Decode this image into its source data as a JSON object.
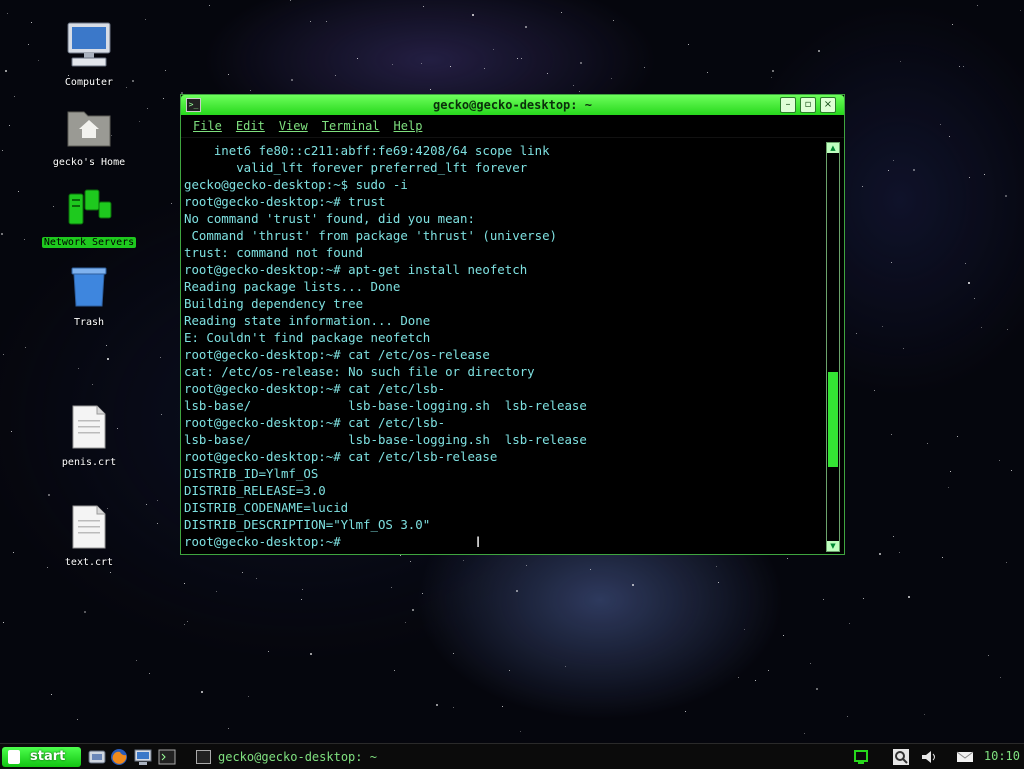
{
  "desktop": {
    "icons": [
      {
        "label": "Computer"
      },
      {
        "label": "gecko's Home"
      },
      {
        "label": "Network Servers"
      },
      {
        "label": "Trash"
      },
      {
        "label": "penis.crt"
      },
      {
        "label": "text.crt"
      }
    ]
  },
  "window": {
    "title": "gecko@gecko-desktop: ~",
    "menu": [
      "File",
      "Edit",
      "View",
      "Terminal",
      "Help"
    ],
    "lines": [
      "    inet6 fe80::c211:abff:fe69:4208/64 scope link",
      "       valid_lft forever preferred_lft forever",
      "gecko@gecko-desktop:~$ sudo -i",
      "root@gecko-desktop:~# trust",
      "No command 'trust' found, did you mean:",
      " Command 'thrust' from package 'thrust' (universe)",
      "trust: command not found",
      "root@gecko-desktop:~# apt-get install neofetch",
      "Reading package lists... Done",
      "Building dependency tree",
      "Reading state information... Done",
      "E: Couldn't find package neofetch",
      "root@gecko-desktop:~# cat /etc/os-release",
      "cat: /etc/os-release: No such file or directory",
      "root@gecko-desktop:~# cat /etc/lsb-",
      "lsb-base/             lsb-base-logging.sh  lsb-release",
      "root@gecko-desktop:~# cat /etc/lsb-",
      "lsb-base/             lsb-base-logging.sh  lsb-release",
      "root@gecko-desktop:~# cat /etc/lsb-release",
      "DISTRIB_ID=Ylmf_OS",
      "DISTRIB_RELEASE=3.0",
      "DISTRIB_CODENAME=lucid",
      "DISTRIB_DESCRIPTION=\"Ylmf_OS 3.0\"",
      "root@gecko-desktop:~# "
    ],
    "scroll_position": 0.75
  },
  "taskbar": {
    "start_label": "start",
    "task_title": "gecko@gecko-desktop: ~",
    "clock": "10:10"
  },
  "colors": {
    "accent": "#27d81c",
    "terminal_text": "#7ee0e0",
    "background": "#05060d"
  }
}
